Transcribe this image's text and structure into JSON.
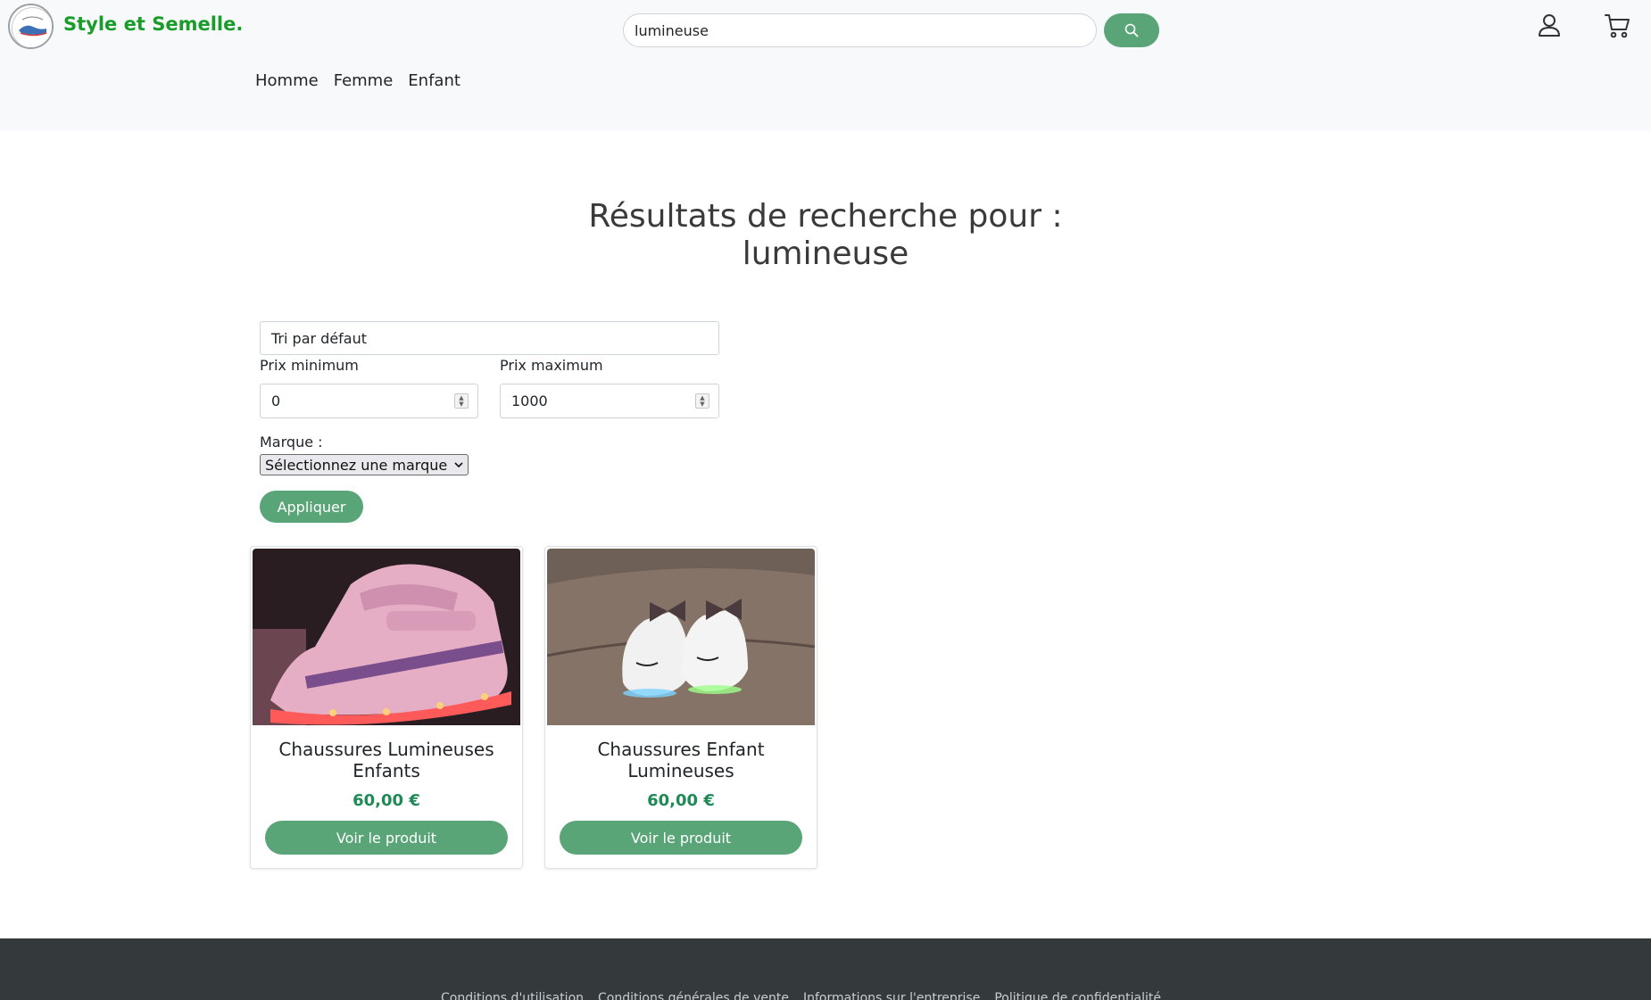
{
  "header": {
    "brand": "Style et Semelle.",
    "search_value": "lumineuse",
    "icons": [
      "logo-icon",
      "search-icon",
      "user-icon",
      "cart-icon"
    ]
  },
  "nav": [
    {
      "label": "Homme"
    },
    {
      "label": "Femme"
    },
    {
      "label": "Enfant"
    }
  ],
  "results": {
    "title_line1": "Résultats de recherche pour :",
    "title_line2": "lumineuse"
  },
  "filters": {
    "sort_value": "Tri par défaut",
    "min_label": "Prix minimum",
    "min_value": "0",
    "max_label": "Prix maximum",
    "max_value": "1000",
    "brand_label": "Marque :",
    "brand_value": "Sélectionnez une marque",
    "apply_label": "Appliquer"
  },
  "products": [
    {
      "name": "Chaussures Lumineuses Enfants",
      "price": "60,00 €",
      "button": "Voir le produit"
    },
    {
      "name": "Chaussures Enfant Lumineuses",
      "price": "60,00 €",
      "button": "Voir le produit"
    }
  ],
  "footer": {
    "links": [
      "Conditions d'utilisation",
      "Conditions générales de vente",
      "Informations sur l'entreprise",
      "Politique de confidentialité"
    ]
  },
  "colors": {
    "brand": "#1a9c2a",
    "accent": "#5aa577",
    "price": "#1f8a56",
    "footer": "#343a3c"
  }
}
